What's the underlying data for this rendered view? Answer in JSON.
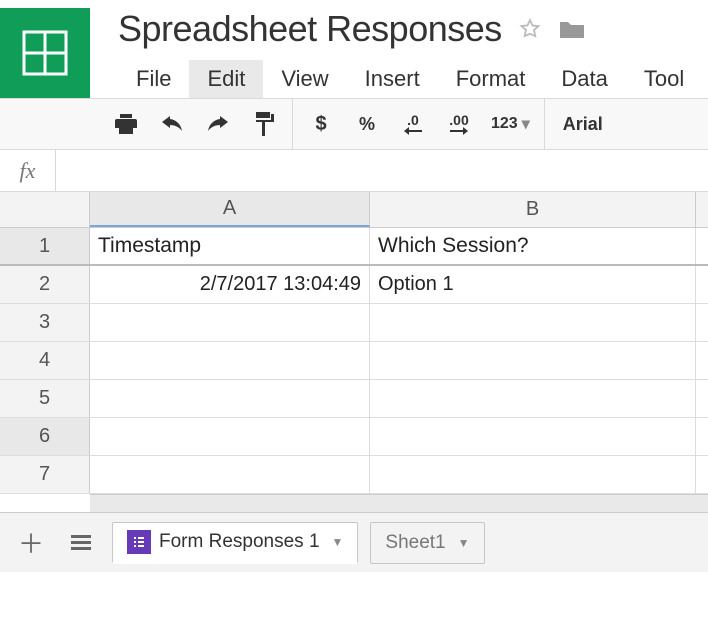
{
  "doc": {
    "title": "Spreadsheet Responses"
  },
  "menus": {
    "file": "File",
    "edit": "Edit",
    "view": "View",
    "insert": "Insert",
    "format": "Format",
    "data": "Data",
    "tools": "Tool"
  },
  "toolbar": {
    "currency": "$",
    "percent": "%",
    "dec_decrease": ".0",
    "dec_increase": ".00",
    "num_format": "123",
    "font": "Arial"
  },
  "formula": {
    "label": "fx",
    "value": ""
  },
  "columns": {
    "a": "A",
    "b": "B"
  },
  "rows": [
    "1",
    "2",
    "3",
    "4",
    "5",
    "6",
    "7"
  ],
  "cells": {
    "a1": "Timestamp",
    "b1": "Which Session?",
    "a2": "2/7/2017 13:04:49",
    "b2": "Option 1"
  },
  "sheets": {
    "active": "Form Responses 1",
    "other": "Sheet1"
  }
}
